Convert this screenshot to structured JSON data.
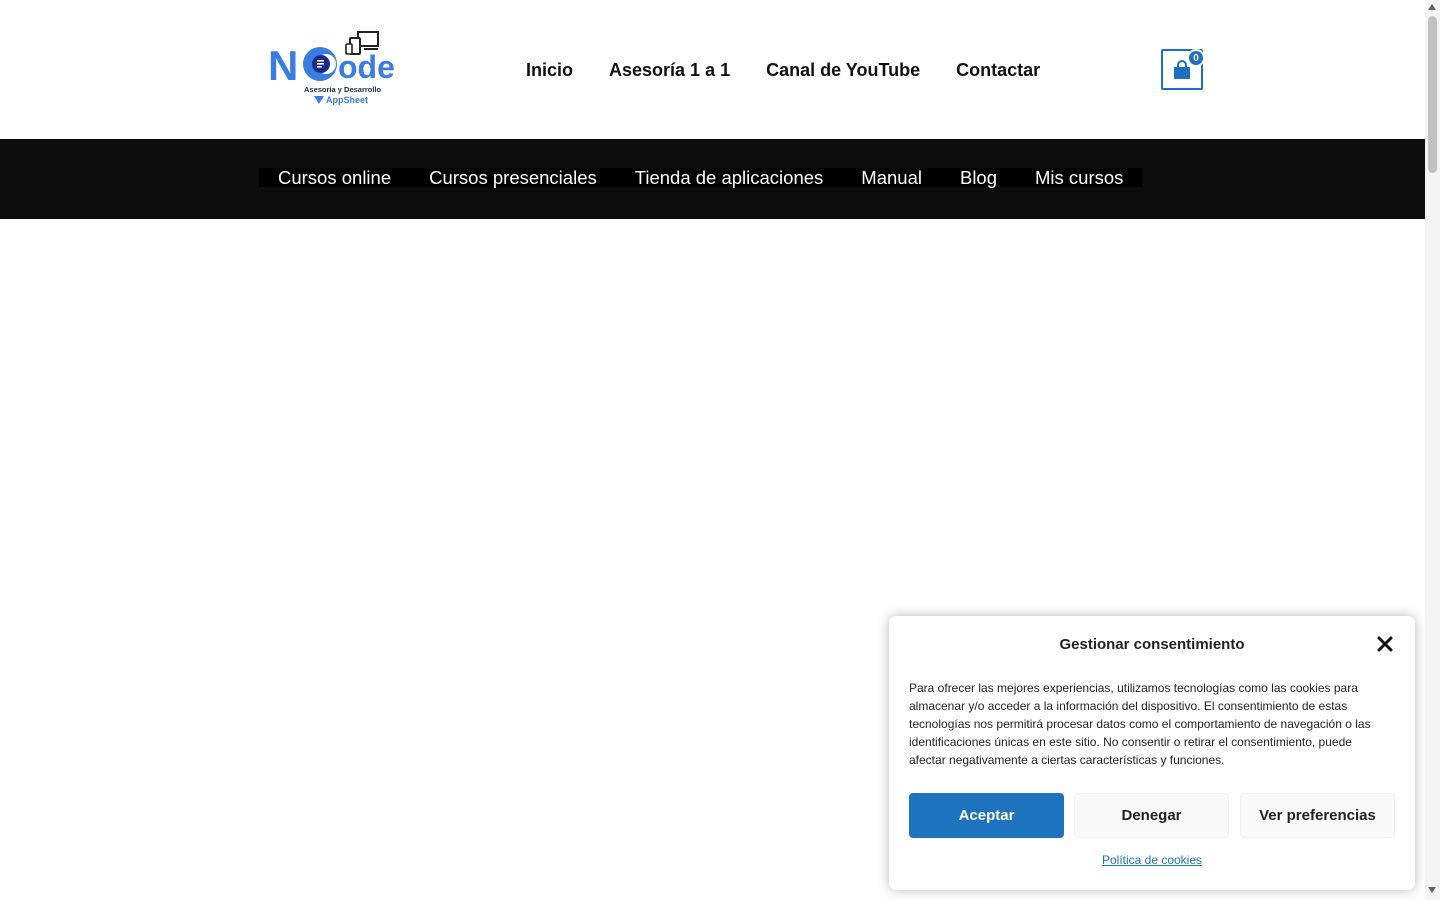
{
  "header": {
    "logo": {
      "word_left": "N",
      "word_right": "ode",
      "subtitle_line1": "Asesoría y Desarrollo",
      "subtitle_line2": "AppSheet",
      "brand_color": "#3a7de0"
    },
    "nav": [
      {
        "label": "Inicio"
      },
      {
        "label": "Asesoría 1 a 1"
      },
      {
        "label": "Canal de YouTube"
      },
      {
        "label": "Contactar"
      }
    ],
    "cart": {
      "icon": "shopping-bag-icon",
      "count": "0",
      "color": "#1c6fc1"
    }
  },
  "subnav": {
    "background": "#0c0c0c",
    "items": [
      {
        "label": "Cursos online"
      },
      {
        "label": "Cursos presenciales"
      },
      {
        "label": "Tienda de aplicaciones"
      },
      {
        "label": "Manual"
      },
      {
        "label": "Blog"
      },
      {
        "label": "Mis cursos"
      }
    ]
  },
  "consent": {
    "title": "Gestionar consentimiento",
    "close_icon": "close-icon",
    "body": "Para ofrecer las mejores experiencias, utilizamos tecnologías como las cookies para almacenar y/o acceder a la información del dispositivo. El consentimiento de estas tecnologías nos permitirá procesar datos como el comportamiento de navegación o las identificaciones únicas en este sitio. No consentir o retirar el consentimiento, puede afectar negativamente a ciertas características y funciones.",
    "accept_label": "Aceptar",
    "deny_label": "Denegar",
    "preferences_label": "Ver preferencias",
    "policy_link": "Política de cookies",
    "accent_color": "#1e73be"
  }
}
